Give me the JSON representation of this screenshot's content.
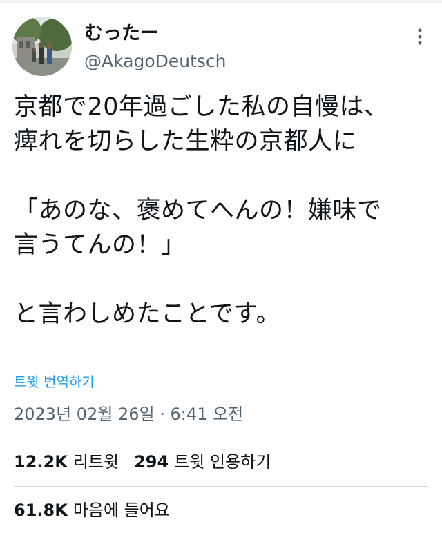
{
  "author": {
    "display_name": "むったー",
    "handle": "@AkagoDeutsch"
  },
  "tweet": {
    "lines": [
      "京都で20年過ごした私の自慢は、",
      "痺れを切らした生粋の京都人に",
      "",
      "「あのな、褒めてへんの！嫌味で",
      "言うてんの！」",
      "",
      "と言わしめたことです。"
    ],
    "translate_label": "트윗 번역하기",
    "timestamp": "2023년 02월 26일 · 6:41 오전"
  },
  "stats": {
    "retweets_count": "12.2K",
    "retweets_label": "리트윗",
    "quotes_count": "294",
    "quotes_label": "트윗 인용하기",
    "likes_count": "61.8K",
    "likes_label": "마음에 들어요"
  },
  "icons": {
    "more": "more-vertical-icon"
  },
  "colors": {
    "text": "#0f1419",
    "secondary": "#536471",
    "link": "#1d9bf0",
    "divider": "#cfd9de"
  }
}
